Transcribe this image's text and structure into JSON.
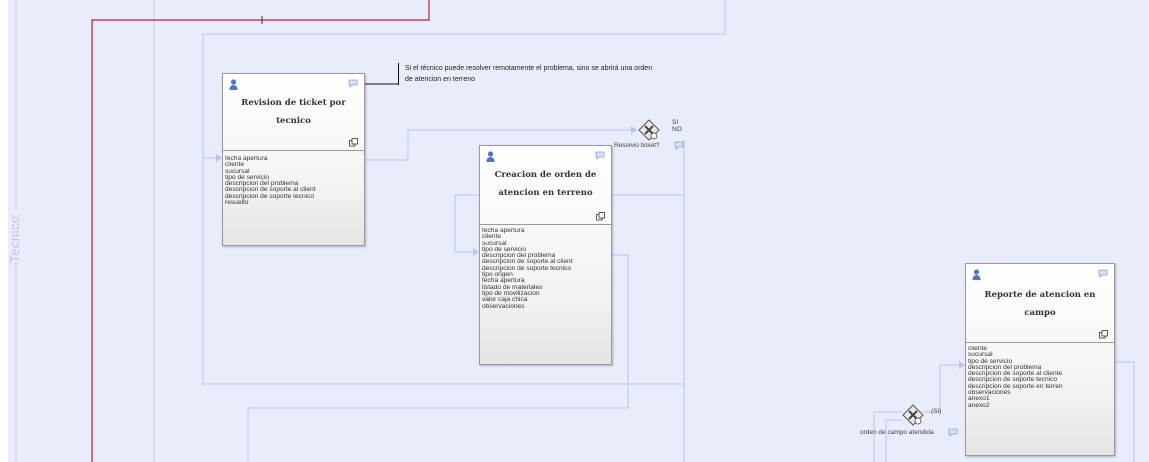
{
  "lane": {
    "label": "Tecnico"
  },
  "tasks": [
    {
      "title": "Revision de ticket por tecnico",
      "fields": [
        "fecha apertura",
        "cliente",
        "sucursal",
        "tipo de servicio",
        "descripcion del problema",
        "descripcion de soporte al client",
        "descripcion de soporte tecnico",
        "resuelto"
      ]
    },
    {
      "title": "Creacion de orden de atencion en terreno",
      "fields": [
        "fecha apertura",
        "cliente",
        "sucursal",
        "tipo de servicio",
        "descripcion del problema",
        "descripcion de soporte al client",
        "descripcion de soporte tecnico",
        "tipo origen",
        "fecha apertura",
        "listado de materiales",
        "tipo de movilizacion",
        "valor caja chica",
        "observaciones"
      ]
    },
    {
      "title": "Reporte de atencion en campo",
      "fields": [
        "cliente",
        "sucursal",
        "tipo de servicio",
        "descripcion del problema",
        "descripcion de soporte al cliente",
        "descripcion de soporte tecnico",
        "descripcion de soporte en terren",
        "observaciones",
        "anexo1",
        "anexo2"
      ]
    }
  ],
  "gateways": [
    {
      "label": "Resolvio ticket?",
      "out_yes": "SI",
      "out_no": "NO"
    },
    {
      "label": "orden de campo atendida",
      "out_yes": "(SI)"
    }
  ],
  "annotation": {
    "lines": [
      "Si el técnico puede resolver remotamente el problema, sino se abrirá una orden",
      "de atencion en terreno"
    ]
  },
  "colors": {
    "lane_background": "#e9ecfb",
    "sequence_flow": "#b9c3f0",
    "message_flow": "#c0202a",
    "lane_label": "#bcc4ec"
  },
  "icons": [
    "user-icon",
    "comment-icon",
    "subprocess-icon",
    "gateway-icon"
  ]
}
